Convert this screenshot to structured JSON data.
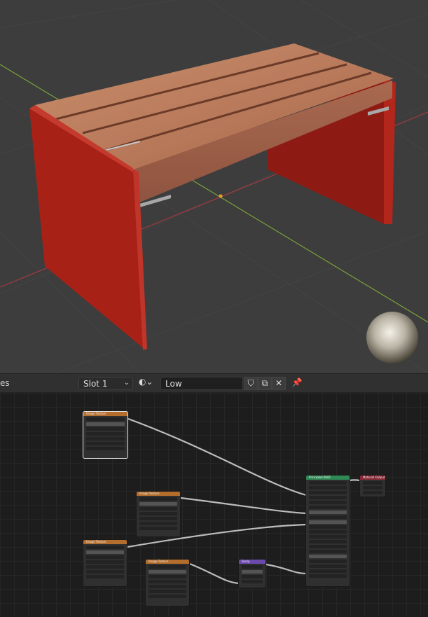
{
  "header": {
    "left_text": "es",
    "slot_label": "Slot 1",
    "slot_chevron": "⌄",
    "shader_icon": "◐⌄",
    "material_name": "Low",
    "shield_icon": "⛉",
    "copy_icon": "⧉",
    "close_icon": "✕",
    "pin_icon": "📌"
  },
  "nodes": {
    "texture_title": "Image Texture",
    "bsdf_title": "Principled BSDF",
    "output_title": "Material Output",
    "bump_title": "Bump"
  },
  "colors": {
    "texture_header": "#b36d2c",
    "bsdf_header": "#2f8a56",
    "output_header": "#8b2a36",
    "bump_header": "#6b4ab0",
    "bench_red": "#b3261c",
    "wood": "#b5785a"
  }
}
